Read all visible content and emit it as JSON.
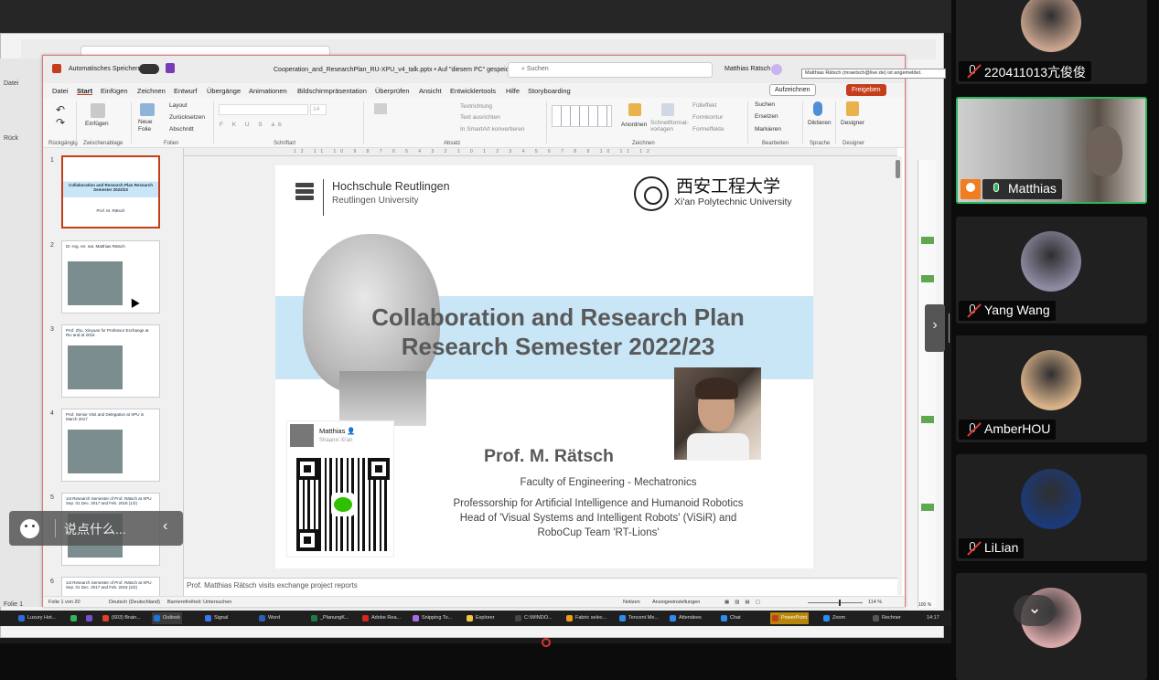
{
  "ppt": {
    "autosave_label": "Automatisches Speichern",
    "filename": "Cooperation_and_ResearchPlan_RU-XPU_v4_talk.pptx • Auf \"diesem PC\" gespeichert ⌄",
    "search_placeholder": "Suchen",
    "user_name": "Matthias Rätsch",
    "user_tooltip": "Matthias Rätsch (mraetsch@live.de) ist angemeldet.",
    "menu": [
      "Datei",
      "Start",
      "Einfügen",
      "Zeichnen",
      "Entwurf",
      "Übergänge",
      "Animationen",
      "Bildschirmpräsentation",
      "Überprüfen",
      "Ansicht",
      "Entwicklertools",
      "Hilfe",
      "Storyboarding"
    ],
    "menu_active": "Start",
    "btn_comments": "Aufzeichnen",
    "btn_share": "Freigeben",
    "ribbon": {
      "paste": "Einfügen",
      "layout": "Layout",
      "reset": "Zurücksetzen",
      "new_slide": "Neue Folie",
      "section": "Abschnitt",
      "font_size": "14",
      "text_direction": "Textrichtung",
      "align_text": "Text ausrichten",
      "smartart": "In SmartArt konvertieren",
      "arrange": "Anordnen",
      "quick_styles": "Schnellformat-vorlagen",
      "fill": "Fülleffekt",
      "outline": "Formkontur",
      "effects": "Formeffekte",
      "find": "Suchen",
      "replace": "Ersetzen",
      "select": "Markieren",
      "dictate": "Diktieren",
      "designer": "Designer",
      "groups": [
        "Rückgängig",
        "Zwischenablage",
        "Folien",
        "Schriftart",
        "Absatz",
        "Zeichnen",
        "Bearbeiten",
        "Sprache",
        "Designer"
      ]
    },
    "ruler": "12 11 10 9 8 7 6 5 4 3 2 1 0 1 2 3 4 5 6 7 8 9 10 11 12",
    "thumbnails": [
      {
        "num": "1",
        "title": "Collaboration and Research Plan Research Semester 2022/23",
        "sub": "Prof. M. Rätsch"
      },
      {
        "num": "2",
        "title": "Dr.-Ing. rer. nat. Matthias Rätsch"
      },
      {
        "num": "3",
        "title": "Prof. Zhu, Xinyuan for Professor Exchange at RU and at 2016"
      },
      {
        "num": "4",
        "title": "Prof. Senior Visit and Delegation at XPU in March 2017"
      },
      {
        "num": "5",
        "title": "1st Research Semester of Prof. Rätsch at XPU Sep. 01 Dec. 2017 and Feb. 2018 (1/2)"
      },
      {
        "num": "6",
        "title": "1st Research Semester of Prof. Rätsch at XPU Sep. 01 Dec. 2017 and Feb. 2018 (2/2)"
      }
    ],
    "slide": {
      "hsr_name": "Hochschule Reutlingen",
      "hsr_sub": "Reutlingen University",
      "xpu_cn": "西安工程大学",
      "xpu_en": "Xi'an Polytechnic University",
      "title1": "Collaboration and Research Plan",
      "title2": "Research Semester 2022/23",
      "prof": "Prof. M. Rätsch",
      "faculty": "Faculty of Engineering - Mechatronics",
      "line1": "Professorship for Artificial Intelligence and Humanoid Robotics",
      "line2": "Head of 'Visual Systems and Intelligent Robots' (ViSiR) and",
      "line3": "RoboCup Team 'RT-Lions'",
      "wechat_name": "Matthias 👤",
      "wechat_loc": "Shaanxi Xi'an"
    },
    "notes": "Prof. Matthias Rätsch visits exchange project reports",
    "status": {
      "slide": "Folie 1 von 20",
      "lang": "Deutsch (Deutschland)",
      "access": "Barrierefreiheit: Untersuchen",
      "notes": "Notizen",
      "display": "Anzeigeeinstellungen",
      "zoom": "114 %"
    }
  },
  "background": {
    "left_labels": [
      "Datei",
      "Rück"
    ],
    "bottom_label": "Folie 1",
    "zoom_right": "100 %"
  },
  "chat": {
    "placeholder": "说点什么..."
  },
  "taskbar": [
    {
      "label": "Luxury Hot...",
      "color": "#2b6fd6"
    },
    {
      "label": "",
      "color": "#2db55d"
    },
    {
      "label": "",
      "color": "#7a4dd8"
    },
    {
      "label": "(603) Brain...",
      "color": "#e0412a"
    },
    {
      "label": "Outlook",
      "color": "#1e73d8",
      "on": true
    },
    {
      "label": "Signal",
      "color": "#3a76f0"
    },
    {
      "label": "Word",
      "color": "#2b5fb5"
    },
    {
      "label": "_PlanungK...",
      "color": "#1d7c45"
    },
    {
      "label": "Adobe Rea...",
      "color": "#d8271c"
    },
    {
      "label": "Snipping To...",
      "color": "#a86de0"
    },
    {
      "label": "Explorer",
      "color": "#f4c542"
    },
    {
      "label": "C:\\WINDO...",
      "color": "#444"
    },
    {
      "label": "Fabric selec...",
      "color": "#f09a1a"
    },
    {
      "label": "Tencent Me...",
      "color": "#2d8cf0"
    },
    {
      "label": "Attendees",
      "color": "#2d8cf0"
    },
    {
      "label": "Chat",
      "color": "#2d8cf0"
    },
    {
      "label": "PowerPoint",
      "color": "#c43e1c",
      "hl": true
    },
    {
      "label": "Zoom",
      "color": "#2d8cf0"
    },
    {
      "label": "Rechner",
      "color": "#555"
    }
  ],
  "clock": "14:17",
  "participants": [
    {
      "name": "220411013亢俊俊",
      "muted": true,
      "color": "#c9a48f"
    },
    {
      "name": "Matthias",
      "muted": false,
      "host": true,
      "color": "#6f625a",
      "speaking": true
    },
    {
      "name": "Yang Wang",
      "muted": true,
      "color": "#8e8ba3"
    },
    {
      "name": "AmberHOU",
      "muted": true,
      "color": "#d9b28a"
    },
    {
      "name": "LiLian",
      "muted": true,
      "color": "#1b3a7a"
    },
    {
      "name": "",
      "muted": true,
      "color": "#d7a7a9"
    }
  ],
  "colors": {
    "accent": "#c43e1c",
    "speaker": "#2db55d",
    "band": "#c9e6f7"
  }
}
